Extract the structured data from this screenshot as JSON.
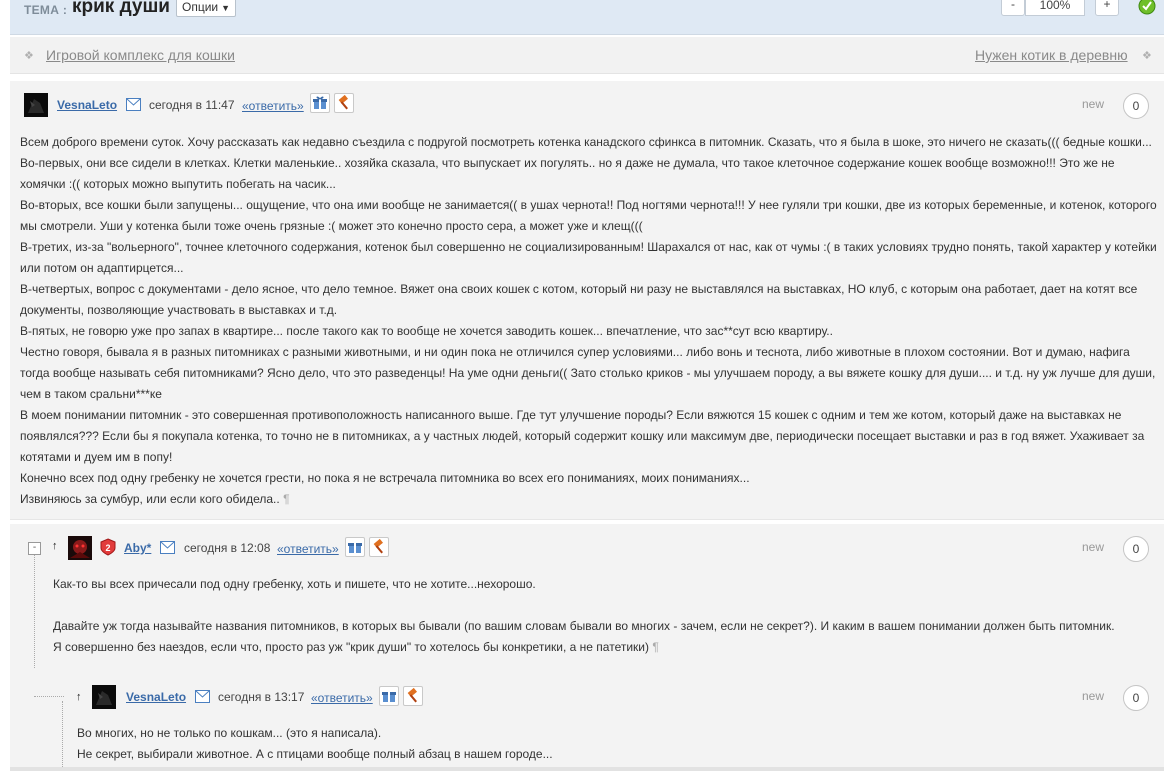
{
  "header": {
    "topic_label": "ТЕМА :",
    "topic_title": "крик души",
    "options_label": "Опции",
    "zoom_minus": "-",
    "zoom_value": "100%",
    "zoom_plus": "+"
  },
  "nav": {
    "prev": "Игровой комплекс для кошки",
    "next": "Нужен котик в деревню"
  },
  "post": {
    "author": "VesnaLeto",
    "date": "сегодня в 11:47",
    "reply": "«ответить»",
    "new_label": "new",
    "count": "0",
    "paragraphs": [
      "Всем доброго времени суток. Хочу рассказать как недавно съездила с подругой посмотреть котенка канадского сфинкса в питомник. Сказать, что я была в шоке, это ничего не сказать((( бедные кошки...",
      "Во-первых, они все сидели в клетках. Клетки маленькие.. хозяйка сказала, что выпускает их погулять.. но я даже не думала, что такое клеточное содержание кошек вообще возможно!!! Это же не хомячки :(( которых можно выпутить побегать на часик...",
      "Во-вторых, все кошки были запущены... ощущение, что она ими вообще не занимается(( в ушах чернота!! Под ногтями чернота!!! У нее гуляли три кошки, две из которых беременные, и котенок, которого мы смотрели. Уши у котенка были тоже очень грязные :( может это конечно просто сера, а может уже и клещ(((",
      "В-третих, из-за \"вольерного\", точнее клеточного содержания, котенок был совершенно не социализированным! Шарахался от нас, как от чумы :( в таких условиях трудно понять, такой характер у котейки или потом он адаптирцется...",
      "В-четвертых, вопрос с документами - дело ясное, что дело темное. Вяжет она своих кошек с котом, который ни разу не выставлялся на выставках, НО клуб, с которым она работает, дает на котят все документы, позволяющие участвовать в выставках и т.д.",
      "В-пятых, не говорю уже про запах в квартире... после такого как то вообще не хочется заводить кошек... впечатление, что зас**сут всю квартиру..",
      "Честно говоря, бывала я в разных питомниках с разными животными, и ни один пока не отличился супер условиями... либо вонь и теснота, либо животные в плохом состоянии. Вот и думаю, нафига тогда вообще называть себя питомниками? Ясно дело, что это разведенцы! На уме одни деньги(( Зато столько криков - мы улучшаем породу, а вы вяжете кошку для души.... и т.д. ну уж лучше для души, чем в таком сральни***ке",
      "В моем понимании питомник - это совершенная противоположность написанного выше. Где тут улучшение породы? Если вяжются 15 кошек с одним и тем же котом, который даже на выставках не появлялся??? Если бы я покупала котенка, то точно не в питомниках, а у частных людей, который содержит кошку или максимум две, периодически посещает выставки и раз в год вяжет. Ухаживает за котятами и дуем им в попу!",
      "Конечно всех под одну гребенку не хочется грести, но пока я не встречала питомника во всех его пониманиях, моих пониманиях...",
      "Извиняюсь за сумбур, или если кого обидела.."
    ],
    "pilcrow": "¶"
  },
  "reply1": {
    "collapse": "-",
    "arrow": "↑",
    "author": "Aby*",
    "date": "сегодня в 12:08",
    "reply": "«ответить»",
    "new_label": "new",
    "count": "0",
    "line1": "Как-то вы всех причесали под одну гребенку, хоть и пишете, что не хотите...нехорошо.",
    "line2": "Давайте уж тогда называйте названия питомников, в которых вы бывали (по вашим словам бывали во многих - зачем, если не секрет?). И каким в вашем понимании должен быть питомник.",
    "line3": "Я совершенно без наездов, если что, просто раз уж \"крик души\" то хотелось бы конкретики, а не патетики)",
    "pilcrow": "¶"
  },
  "reply2": {
    "arrow": "↑",
    "author": "VesnaLeto",
    "date": "сегодня в 13:17",
    "reply": "«ответить»",
    "new_label": "new",
    "count": "0",
    "line1": "Во многих, но не только по кошкам... (это я написала).",
    "line2": "Не секрет, выбирали животное. А с птицами вообще полный абзац в нашем городе..."
  },
  "colors": {
    "link": "#3a6aa8",
    "header_bg": "#dfe9f4",
    "post_bg": "#f3f3f3"
  }
}
